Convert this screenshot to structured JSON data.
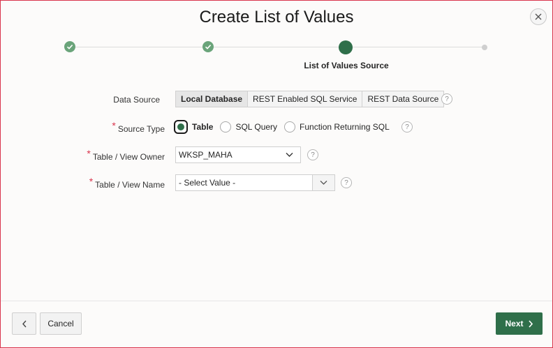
{
  "dialog": {
    "title": "Create List of Values"
  },
  "wizard": {
    "current_step_label": "List of Values Source"
  },
  "form": {
    "data_source": {
      "label": "Data Source",
      "options": [
        "Local Database",
        "REST Enabled SQL Service",
        "REST Data Source"
      ],
      "selected": "Local Database"
    },
    "source_type": {
      "label": "Source Type",
      "options": [
        "Table",
        "SQL Query",
        "Function Returning SQL"
      ],
      "selected": "Table"
    },
    "table_owner": {
      "label": "Table / View Owner",
      "value": "WKSP_MAHA"
    },
    "table_name": {
      "label": "Table / View Name",
      "value": "- Select Value -"
    }
  },
  "footer": {
    "cancel_label": "Cancel",
    "next_label": "Next"
  },
  "colors": {
    "primary": "#2f6f4a",
    "done_step": "#6aa47a",
    "border_accent": "#d9344c"
  }
}
